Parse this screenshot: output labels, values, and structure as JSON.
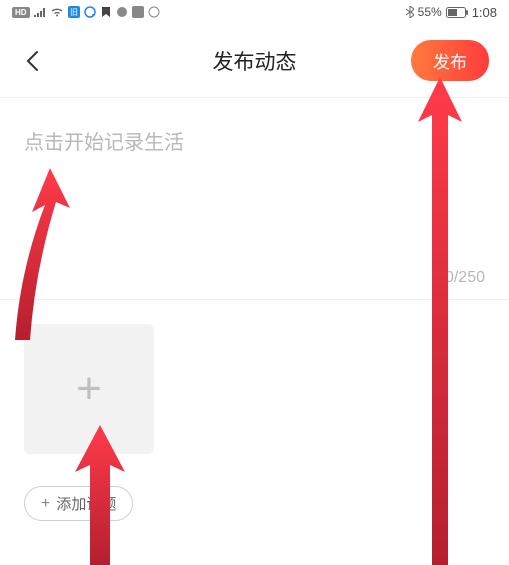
{
  "status_bar": {
    "hd": "HD",
    "signal": "⁴⁶ᴳ",
    "wifi": "📶",
    "bluetooth": "✱",
    "battery_pct": "55%",
    "time": "1:08"
  },
  "header": {
    "title": "发布动态",
    "publish_label": "发布"
  },
  "compose": {
    "placeholder": "点击开始记录生活",
    "counter": "0/250"
  },
  "topic": {
    "label": "添加话题"
  }
}
